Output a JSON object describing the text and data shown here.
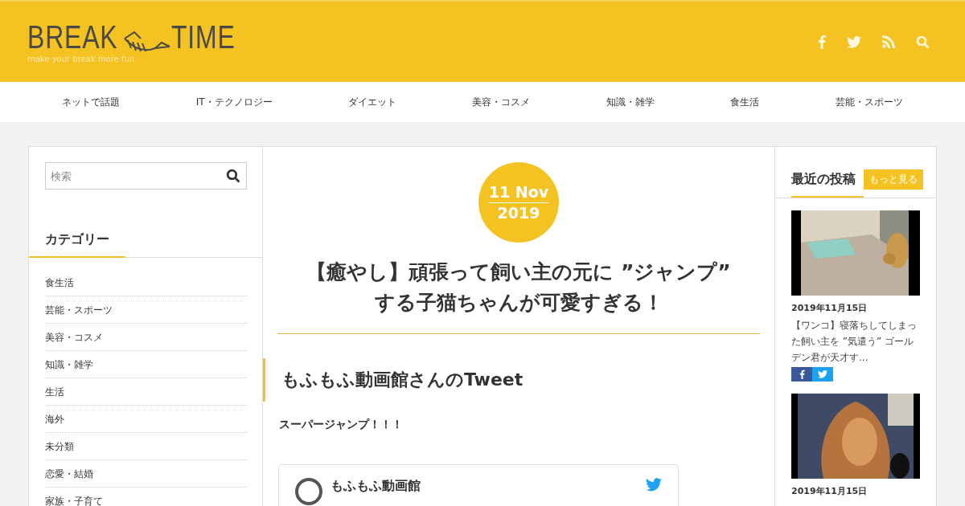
{
  "header": {
    "logo_left": "BREAK",
    "logo_right": "TIME",
    "tagline": "make your break more fun",
    "social": [
      {
        "kind": "facebook"
      },
      {
        "kind": "twitter"
      },
      {
        "kind": "rss"
      },
      {
        "kind": "search"
      }
    ]
  },
  "nav": [
    "ネットで話題",
    "IT・テクノロジー",
    "ダイエット",
    "美容・コスメ",
    "知識・雑学",
    "食生活",
    "芸能・スポーツ"
  ],
  "sidebar": {
    "search": {
      "placeholder": "検索"
    },
    "categories_title": "カテゴリー",
    "categories": [
      "食生活",
      "芸能・スポーツ",
      "美容・コスメ",
      "知識・雑学",
      "生活",
      "海外",
      "未分類",
      "恋愛・結婚",
      "家族・子育て"
    ]
  },
  "article": {
    "date_day": "11 Nov",
    "date_year": "2019",
    "title": "【癒やし】頑張って飼い主の元に ”ジャンプ” する子猫ちゃんが可愛すぎる！",
    "section_heading": "もふもふ動画館さんのTweet",
    "body": "スーパージャンプ！！！",
    "tweet": {
      "author": "もふもふ動画館"
    }
  },
  "recent": {
    "title": "最近の投稿",
    "more": "もっと見る",
    "posts": [
      {
        "date": "2019年11月15日",
        "title": "【ワンコ】寝落ちしてしまった飼い主を ”気遣う” ゴールデン君が天才す...",
        "share": true
      },
      {
        "date": "2019年11月15日"
      }
    ]
  }
}
